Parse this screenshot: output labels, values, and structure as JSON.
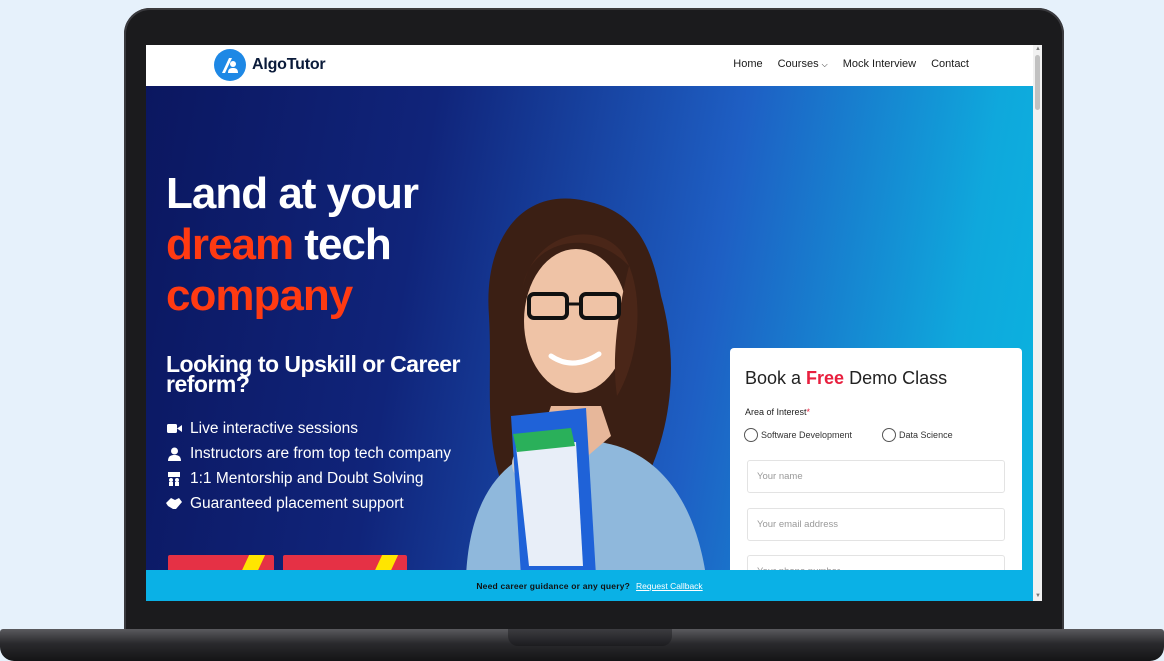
{
  "brand": {
    "name": "AlgoTutor",
    "logo_color": "#1e88e5"
  },
  "nav": {
    "items": [
      {
        "label": "Home",
        "icon": ""
      },
      {
        "label": "Courses",
        "icon": "chevron-down-icon"
      },
      {
        "label": "Mock Interview",
        "icon": ""
      },
      {
        "label": "Contact",
        "icon": ""
      }
    ]
  },
  "hero": {
    "headline": {
      "line1": "Land at your",
      "line2_accent": "dream",
      "line2_rest": " tech",
      "line3_accent": "company"
    },
    "subhead": "Looking to Upskill or Career reform?",
    "features": [
      {
        "icon": "video-camera-icon",
        "text": "Live interactive sessions"
      },
      {
        "icon": "user-icon",
        "text": "Instructors are from top tech company"
      },
      {
        "icon": "mentor-icon",
        "text": "1:1 Mentorship and Doubt Solving"
      },
      {
        "icon": "handshake-icon",
        "text": "Guaranteed placement support"
      }
    ],
    "accent_color": "#ff3a12"
  },
  "form": {
    "title_prefix": "Book a ",
    "title_highlight": "Free",
    "title_suffix": " Demo Class",
    "area_label": "Area of Interest",
    "required_mark": "*",
    "options": [
      "Software Development",
      "Data Science"
    ],
    "fields": {
      "name_placeholder": "Your name",
      "email_placeholder": "Your email address",
      "phone_placeholder": "Your phone number"
    }
  },
  "bottom_bar": {
    "text": "Need career guidance or any query?",
    "link": "Request Callback"
  }
}
